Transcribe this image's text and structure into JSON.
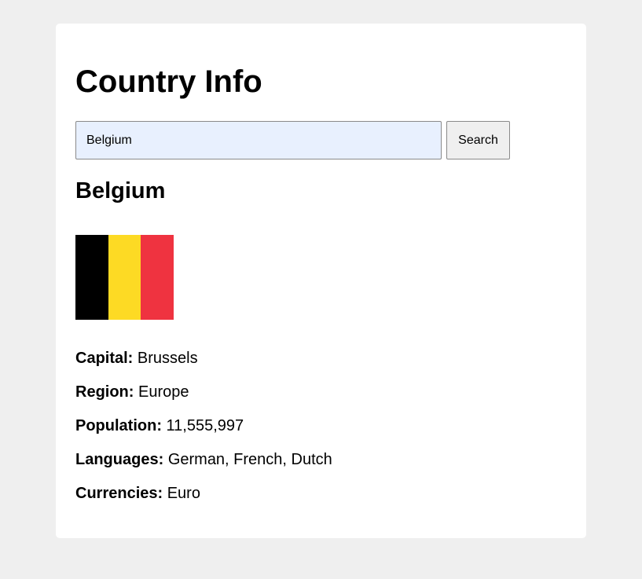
{
  "page": {
    "title": "Country Info"
  },
  "search": {
    "value": "Belgium",
    "button_label": "Search"
  },
  "country": {
    "name": "Belgium",
    "flag": {
      "stripes": [
        "#000000",
        "#fdda24",
        "#ef3340"
      ]
    },
    "details": [
      {
        "label": "Capital:",
        "value": "Brussels"
      },
      {
        "label": "Region:",
        "value": "Europe"
      },
      {
        "label": "Population:",
        "value": "11,555,997"
      },
      {
        "label": "Languages:",
        "value": "German, French, Dutch"
      },
      {
        "label": "Currencies:",
        "value": "Euro"
      }
    ]
  }
}
